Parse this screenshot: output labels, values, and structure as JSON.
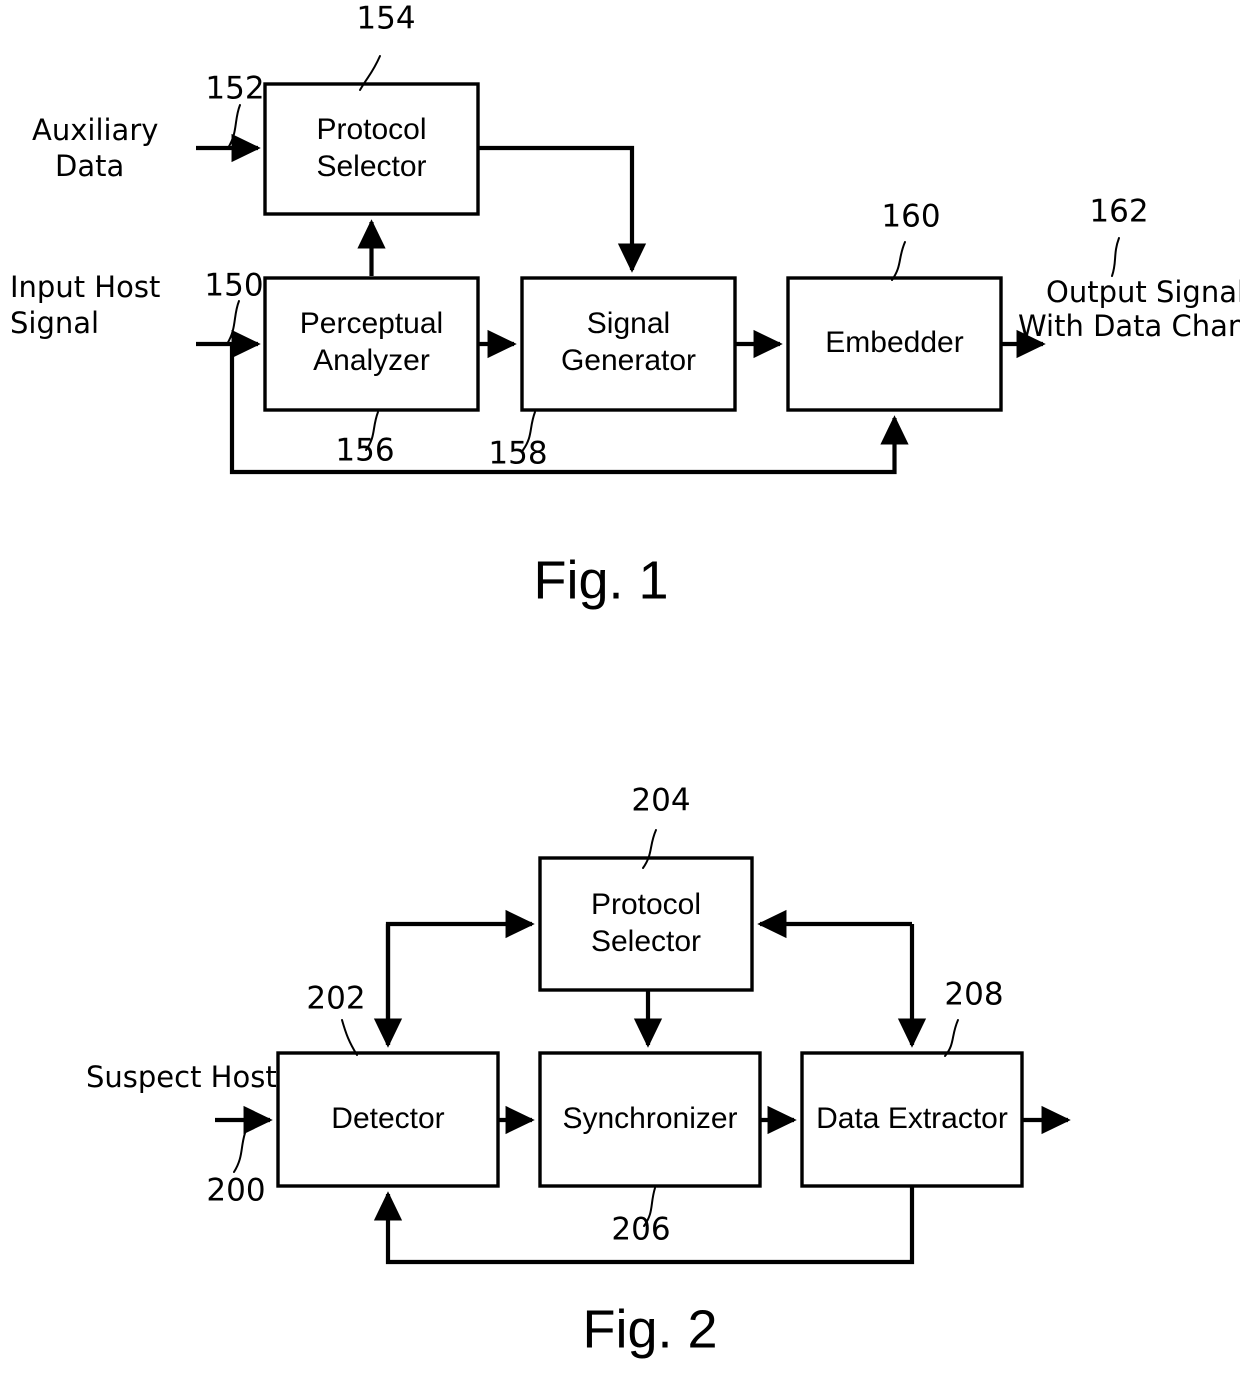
{
  "document": {
    "type": "patent-block-diagram",
    "background_color": "#ffffff",
    "line_color": "#000000"
  },
  "figures": [
    {
      "caption": "Fig. 1",
      "blocks": [
        {
          "id": "protocol-selector-1",
          "label_line1": "Protocol",
          "label_line2": "Selector",
          "ref": "154"
        },
        {
          "id": "perceptual-analyzer",
          "label_line1": "Perceptual",
          "label_line2": "Analyzer",
          "ref": "156"
        },
        {
          "id": "signal-generator",
          "label_line1": "Signal",
          "label_line2": "Generator",
          "ref": "158"
        },
        {
          "id": "embedder",
          "label_line1": "Embedder",
          "label_line2": "",
          "ref": "160"
        }
      ],
      "io_labels": [
        {
          "id": "auxiliary-data",
          "line1": "Auxiliary",
          "line2": "Data",
          "ref": "152"
        },
        {
          "id": "input-host-signal",
          "line1": "Input Host",
          "line2": "Signal",
          "ref": "150"
        },
        {
          "id": "output-signal",
          "line1": "Output Signal",
          "line2": "With Data Channel",
          "ref": "162"
        }
      ],
      "ref_numbers": [
        "150",
        "152",
        "154",
        "156",
        "158",
        "160",
        "162"
      ]
    },
    {
      "caption": "Fig. 2",
      "blocks": [
        {
          "id": "protocol-selector-2",
          "label_line1": "Protocol",
          "label_line2": "Selector",
          "ref": "204"
        },
        {
          "id": "detector",
          "label_line1": "Detector",
          "label_line2": "",
          "ref": "202"
        },
        {
          "id": "synchronizer",
          "label_line1": "Synchronizer",
          "label_line2": "",
          "ref": "206"
        },
        {
          "id": "data-extractor",
          "label_line1": "Data Extractor",
          "label_line2": "",
          "ref": "208"
        }
      ],
      "io_labels": [
        {
          "id": "suspect-host",
          "line1": "Suspect Host",
          "line2": "",
          "ref": "200"
        }
      ],
      "ref_numbers": [
        "200",
        "202",
        "204",
        "206",
        "208"
      ]
    }
  ],
  "text": {
    "fig1_caption": "Fig. 1",
    "fig2_caption": "Fig. 2",
    "protocol_selector_l1": "Protocol",
    "protocol_selector_l2": "Selector",
    "perceptual_analyzer_l1": "Perceptual",
    "perceptual_analyzer_l2": "Analyzer",
    "signal_generator_l1": "Signal",
    "signal_generator_l2": "Generator",
    "embedder": "Embedder",
    "detector": "Detector",
    "synchronizer": "Synchronizer",
    "data_extractor": "Data Extractor",
    "auxiliary_data_l1": "Auxiliary",
    "auxiliary_data_l2": "Data",
    "input_host_l1": "Input Host",
    "input_host_l2": "Signal",
    "output_signal_l1": "Output Signal",
    "output_signal_l2": "With Data Channel",
    "suspect_host": "Suspect Host",
    "ref_150": "150",
    "ref_152": "152",
    "ref_154": "154",
    "ref_156": "156",
    "ref_158": "158",
    "ref_160": "160",
    "ref_162": "162",
    "ref_200": "200",
    "ref_202": "202",
    "ref_204": "204",
    "ref_206": "206",
    "ref_208": "208"
  }
}
